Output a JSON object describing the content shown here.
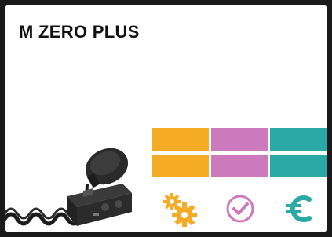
{
  "product": {
    "title": "M ZERO PLUS"
  },
  "rating_grid": {
    "columns": [
      {
        "category": "features",
        "color": "#f5ab24",
        "level": 2,
        "max": 2
      },
      {
        "category": "quality",
        "color": "#cd79bd",
        "level": 2,
        "max": 2
      },
      {
        "category": "price",
        "color": "#2aa9a7",
        "level": 2,
        "max": 2
      }
    ]
  },
  "icons": {
    "features": "gears-icon",
    "quality": "check-circle-icon",
    "price": "euro-icon"
  }
}
